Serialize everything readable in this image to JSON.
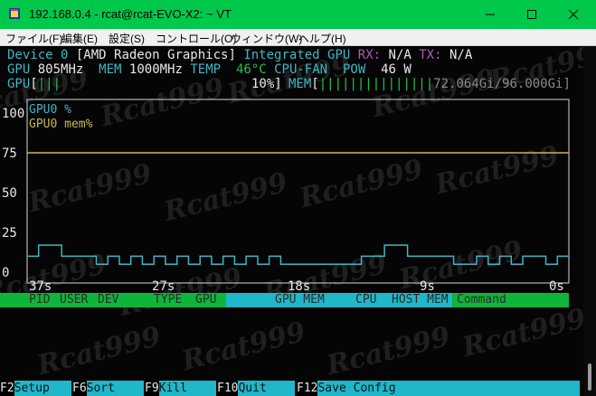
{
  "window": {
    "title": "192.168.0.4 - rcat@rcat-EVO-X2: ~ VT",
    "minimize_icon": "minimize-icon",
    "maximize_icon": "maximize-icon",
    "close_icon": "close-icon"
  },
  "menu": [
    "ファイル(F)",
    "編集(E)",
    "設定(S)",
    "コントロール(O)",
    "ウィンドウ(W)",
    "ヘルプ(H)"
  ],
  "device": {
    "label": "Device 0",
    "name": "[AMD Radeon Graphics]",
    "type": "Integrated GPU",
    "rx_label": "RX:",
    "rx_value": "N/A",
    "tx_label": "TX:",
    "tx_value": "N/A"
  },
  "stats": {
    "gpu_label": "GPU",
    "gpu_clock": "805MHz",
    "mem_label": "MEM",
    "mem_clock": "1000MHz",
    "temp_label": "TEMP",
    "temp_value": "46°C",
    "fan_label": "CPU-FAN",
    "pow_label": "POW",
    "pow_value": "46 W"
  },
  "bars": {
    "gpu_label": "GPU",
    "gpu_open": "[",
    "gpu_fill": "|||",
    "gpu_value": "10%]",
    "gpu_percent": 10,
    "mem_label": "MEM",
    "mem_open": "[",
    "mem_fill": "|||||||||||||||",
    "mem_value": "72.064Gi/96.000Gi]",
    "mem_fraction": 0.75
  },
  "chart_data": {
    "type": "line",
    "series": [
      {
        "name": "GPU0 %",
        "color": "#3fb6c6",
        "values": [
          10,
          17,
          17,
          10,
          10,
          10,
          5,
          10,
          5,
          10,
          5,
          10,
          5,
          10,
          5,
          10,
          5,
          10,
          5,
          10,
          5,
          10,
          5,
          5,
          5,
          5,
          5,
          5,
          5,
          10,
          10,
          17,
          17,
          10,
          10,
          10,
          10,
          5,
          5,
          10,
          5,
          10,
          5,
          10,
          10,
          5,
          10
        ]
      },
      {
        "name": "GPU0 mem%",
        "color": "#c8b84a",
        "values": [
          75,
          75,
          75,
          75,
          75,
          75,
          75,
          75,
          75,
          75,
          75,
          75,
          75,
          75,
          75,
          75,
          75,
          75,
          75,
          75,
          75,
          75,
          75,
          75,
          75,
          75,
          75,
          75,
          75,
          75,
          75,
          75,
          75,
          75,
          75,
          75,
          75,
          75,
          75,
          75,
          75,
          75,
          75,
          75,
          75,
          75,
          75
        ]
      }
    ],
    "y_ticks": [
      "100",
      "75",
      "50",
      "25",
      "0"
    ],
    "x_ticks": [
      "37s",
      "27s",
      "18s",
      "9s",
      "0s"
    ],
    "ylim": [
      0,
      100
    ]
  },
  "process_header": {
    "pid": "PID",
    "user": "USER",
    "dev": "DEV",
    "type": "TYPE",
    "gpu": "GPU",
    "gpu_mem": "GPU MEM",
    "cpu": "CPU",
    "host_mem": "HOST MEM",
    "command": "Command"
  },
  "fkeys": [
    {
      "key": "F2",
      "action": "Setup"
    },
    {
      "key": "F6",
      "action": "Sort"
    },
    {
      "key": "F9",
      "action": "Kill"
    },
    {
      "key": "F10",
      "action": "Quit"
    },
    {
      "key": "F12",
      "action": "Save Config"
    }
  ],
  "watermark": "Rcat999"
}
